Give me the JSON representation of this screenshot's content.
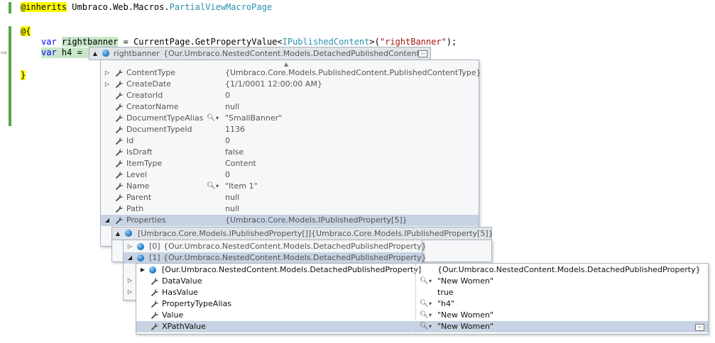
{
  "code": {
    "line1": {
      "kw": "@inherits",
      "ns": "Umbraco.Web.Macros.",
      "cls": "PartialViewMacroPage"
    },
    "line3": {
      "text": "@{"
    },
    "line4": {
      "kw": "var",
      "var": "rightbanner",
      "mid": " = CurrentPage.GetPropertyValue<",
      "type": "IPublishedContent",
      "mid2": ">(",
      "str": "\"rightBanner\"",
      "end": ");"
    },
    "line5": {
      "kw": "var",
      "rest": " h4 = ("
    },
    "line7": {
      "text": "}"
    }
  },
  "tooltip": {
    "name": "rightbanner",
    "value": "{Our.Umbraco.NestedContent.Models.DetachedPublishedContent}"
  },
  "panel1": {
    "rows": [
      {
        "name": "ContentType",
        "value": "{Umbraco.Core.Models.PublishedContent.PublishedContentType}",
        "expand": true,
        "mag": false
      },
      {
        "name": "CreateDate",
        "value": "{1/1/0001 12:00:00 AM}",
        "expand": true,
        "mag": false
      },
      {
        "name": "CreatorId",
        "value": "0",
        "expand": false,
        "mag": false
      },
      {
        "name": "CreatorName",
        "value": "null",
        "expand": false,
        "mag": false
      },
      {
        "name": "DocumentTypeAlias",
        "value": "\"SmallBanner\"",
        "expand": false,
        "mag": true
      },
      {
        "name": "DocumentTypeId",
        "value": "1136",
        "expand": false,
        "mag": false
      },
      {
        "name": "Id",
        "value": "0",
        "expand": false,
        "mag": false
      },
      {
        "name": "IsDraft",
        "value": "false",
        "expand": false,
        "mag": false
      },
      {
        "name": "ItemType",
        "value": "Content",
        "expand": false,
        "mag": false
      },
      {
        "name": "Level",
        "value": "0",
        "expand": false,
        "mag": false
      },
      {
        "name": "Name",
        "value": "\"Item 1\"",
        "expand": false,
        "mag": true
      },
      {
        "name": "Parent",
        "value": "null",
        "expand": false,
        "mag": false
      },
      {
        "name": "Path",
        "value": "null",
        "expand": false,
        "mag": false
      },
      {
        "name": "Properties",
        "value": "{Umbraco.Core.Models.IPublishedProperty[5]}",
        "expand": false,
        "mag": false,
        "open": true
      }
    ]
  },
  "panel2": {
    "header_name": "[Umbraco.Core.Models.IPublishedProperty[]]",
    "header_value": "{Umbraco.Core.Models.IPublishedProperty[5]}"
  },
  "panel3": {
    "rows": [
      {
        "index": "[0]",
        "value": "{Our.Umbraco.NestedContent.Models.DetachedPublishedProperty}"
      },
      {
        "index": "[1]",
        "value": "{Our.Umbraco.NestedContent.Models.DetachedPublishedProperty}"
      }
    ]
  },
  "panel4": {
    "header_name": "[Our.Umbraco.NestedContent.Models.DetachedPublishedProperty]",
    "header_value": "{Our.Umbraco.NestedContent.Models.DetachedPublishedProperty}",
    "rows": [
      {
        "name": "DataValue",
        "value": "\"New Women\"",
        "mag": true
      },
      {
        "name": "HasValue",
        "value": "true",
        "mag": false
      },
      {
        "name": "PropertyTypeAlias",
        "value": "\"h4\"",
        "mag": true
      },
      {
        "name": "Value",
        "value": "\"New Women\"",
        "mag": true
      },
      {
        "name": "XPathValue",
        "value": "\"New Women\"",
        "mag": true
      }
    ]
  },
  "icons": {
    "wrench": "wrench-icon",
    "cube": "object-cube-icon",
    "magnifier": "magnifier-icon",
    "pin": "pin-icon"
  }
}
